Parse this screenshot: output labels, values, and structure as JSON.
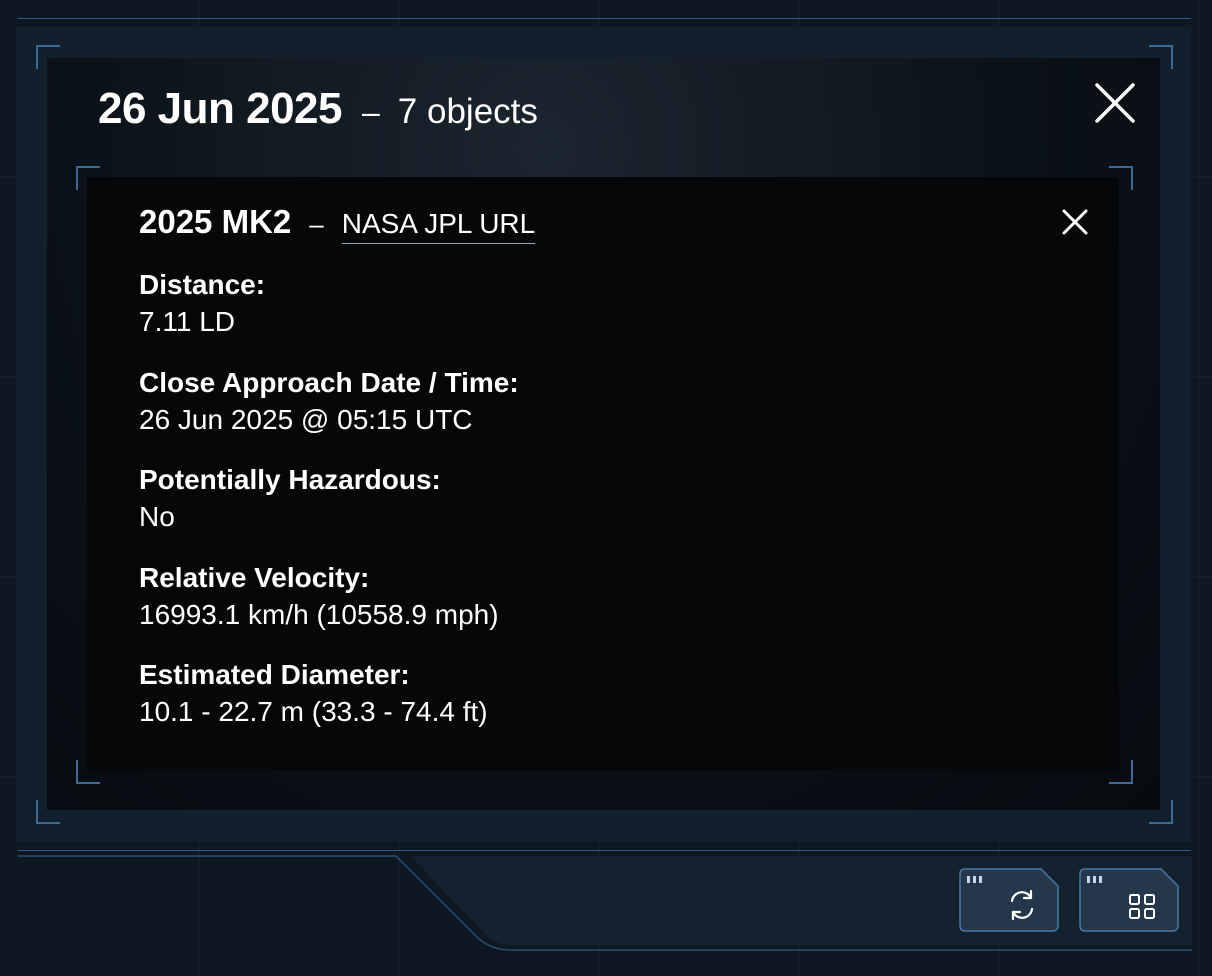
{
  "header": {
    "date": "26 Jun 2025",
    "separator": "–",
    "count": "7 objects"
  },
  "card": {
    "name": "2025 MK2",
    "separator": "–",
    "link_label": "NASA JPL URL",
    "fields": [
      {
        "label": "Distance:",
        "value": "7.11 LD"
      },
      {
        "label": "Close Approach Date / Time:",
        "value": "26 Jun 2025 @ 05:15 UTC"
      },
      {
        "label": "Potentially Hazardous:",
        "value": "No"
      },
      {
        "label": "Relative Velocity:",
        "value": "16993.1 km/h  (10558.9 mph)"
      },
      {
        "label": "Estimated Diameter:",
        "value": "10.1 - 22.7 m  (33.3 - 74.4 ft)"
      }
    ]
  },
  "icons": {
    "close_outer": "close-icon",
    "close_card": "close-icon",
    "refresh": "refresh-icon",
    "grid": "grid-icon"
  },
  "colors": {
    "accent": "#3d6a95",
    "panel": "#12202d",
    "button": "#26384d"
  }
}
